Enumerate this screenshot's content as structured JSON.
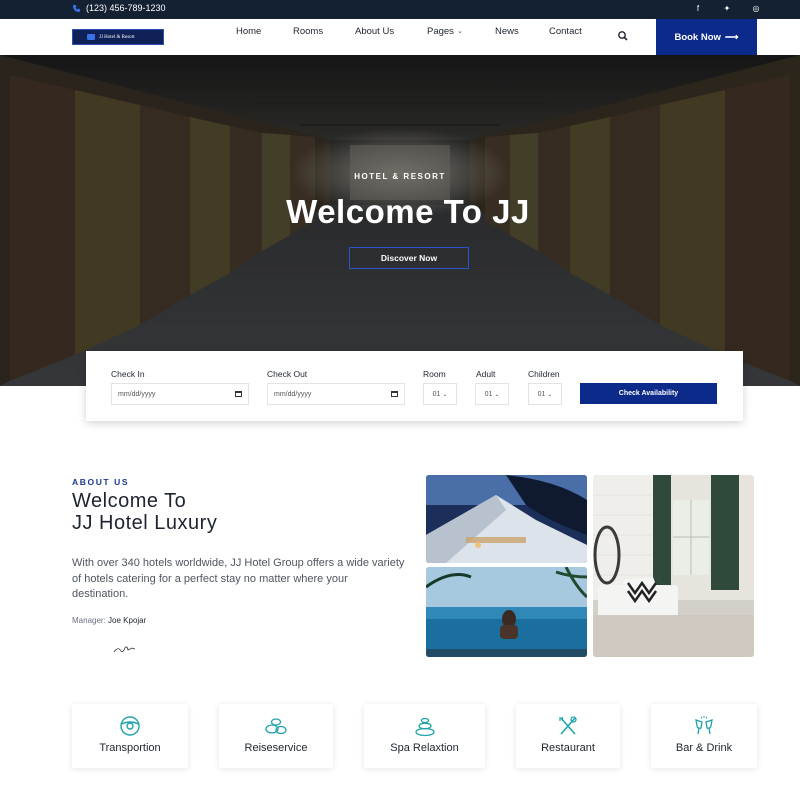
{
  "topbar": {
    "phone": "(123) 456-789-1230",
    "social": [
      "facebook-icon",
      "twitter-icon",
      "instagram-icon"
    ],
    "social_glyphs": [
      "f",
      "✦",
      "◎"
    ]
  },
  "header": {
    "logo_text": "JJ Hotel & Resort",
    "nav": [
      "Home",
      "Rooms",
      "About Us",
      "Pages",
      "News",
      "Contact"
    ],
    "book_label": "Book Now",
    "book_arrow": "⟶"
  },
  "hero": {
    "eyebrow": "HOTEL & RESORT",
    "title": "Welcome To JJ",
    "cta": "Discover Now"
  },
  "booking": {
    "check_in_label": "Check In",
    "check_in_value": "mm/dd/yyyy",
    "check_out_label": "Check Out",
    "check_out_value": "mm/dd/yyyy",
    "room_label": "Room",
    "room_value": "01",
    "adult_label": "Adult",
    "adult_value": "01",
    "children_label": "Children",
    "children_value": "01",
    "submit": "Check Availability"
  },
  "about": {
    "eyebrow": "ABOUT US",
    "title_line1": "Welcome To",
    "title_line2": "JJ Hotel Luxury",
    "text": "With over 340 hotels worldwide, JJ Hotel Group offers a wide variety of hotels catering for a perfect stay no matter where your destination.",
    "manager_label": "Manager:",
    "manager_name": "Joe Kpojar"
  },
  "services": [
    {
      "label": "Transportion",
      "icon": "steering-wheel-icon"
    },
    {
      "label": "Reiseservice",
      "icon": "stones-icon"
    },
    {
      "label": "Spa Relaxtion",
      "icon": "spa-stones-icon"
    },
    {
      "label": "Restaurant",
      "icon": "fork-knife-icon"
    },
    {
      "label": "Bar & Drink",
      "icon": "cheers-icon"
    }
  ],
  "colors": {
    "navy": "#132132",
    "brand_blue": "#0b2a8a",
    "accent": "#1a3a8f",
    "icon_teal": "#1fa3a8"
  }
}
